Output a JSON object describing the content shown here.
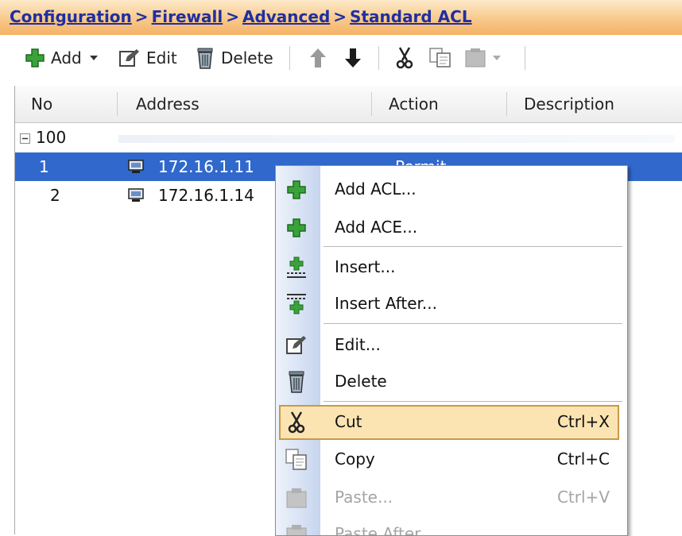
{
  "breadcrumb": {
    "items": [
      "Configuration",
      "Firewall",
      "Advanced",
      "Standard ACL"
    ],
    "separator": ">"
  },
  "toolbar": {
    "add": "Add",
    "edit": "Edit",
    "delete": "Delete"
  },
  "table": {
    "columns": [
      "No",
      "Address",
      "Action",
      "Description"
    ],
    "group": "100",
    "rows": [
      {
        "no": "1",
        "address": "172.16.1.11",
        "action": "Permit"
      },
      {
        "no": "2",
        "address": "172.16.1.14",
        "action": ""
      }
    ]
  },
  "context_menu": {
    "items": [
      {
        "label": "Add ACL...",
        "icon": "add-icon"
      },
      {
        "label": "Add ACE...",
        "icon": "add-icon"
      },
      {
        "label": "Insert...",
        "icon": "insert-icon"
      },
      {
        "label": "Insert After...",
        "icon": "insert-after-icon"
      },
      {
        "label": "Edit...",
        "icon": "edit-icon"
      },
      {
        "label": "Delete",
        "icon": "trash-icon"
      },
      {
        "label": "Cut",
        "shortcut": "Ctrl+X",
        "icon": "scissors-icon",
        "highlighted": true
      },
      {
        "label": "Copy",
        "shortcut": "Ctrl+C",
        "icon": "copy-icon"
      },
      {
        "label": "Paste...",
        "shortcut": "Ctrl+V",
        "icon": "paste-icon",
        "disabled": true
      },
      {
        "label": "Paste After...",
        "icon": "paste-after-icon",
        "disabled": true
      }
    ]
  },
  "colors": {
    "breadcrumb_text": "#1f2fa0",
    "selection": "#3168cc",
    "highlight": "#fbe4b2"
  }
}
